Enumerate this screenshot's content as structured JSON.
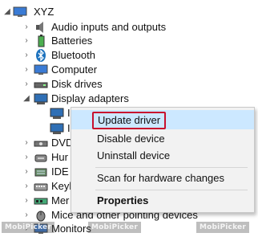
{
  "tree": {
    "root": {
      "label": "XYZ",
      "arrow": "◢"
    },
    "items": [
      {
        "label": "Audio inputs and outputs",
        "icon": "speaker-icon"
      },
      {
        "label": "Batteries",
        "icon": "battery-icon"
      },
      {
        "label": "Bluetooth",
        "icon": "bluetooth-icon"
      },
      {
        "label": "Computer",
        "icon": "computer-icon"
      },
      {
        "label": "Disk drives",
        "icon": "disk-drive-icon"
      },
      {
        "label": "Display adapters",
        "icon": "display-adapter-icon",
        "expanded": true
      },
      {
        "label": "DVD",
        "icon": "dvd-icon"
      },
      {
        "label": "Hur",
        "icon": "hid-icon"
      },
      {
        "label": "IDE A",
        "icon": "ide-icon"
      },
      {
        "label": "Keyb",
        "icon": "keyboard-icon"
      },
      {
        "label": "Mer",
        "icon": "memory-icon"
      },
      {
        "label": "Mice and other pointing devices",
        "icon": "mouse-icon"
      },
      {
        "label": "Monitors",
        "icon": "monitor-icon"
      }
    ],
    "children_prefix": [
      "I",
      "I"
    ]
  },
  "context_menu": {
    "update_driver": "Update driver",
    "disable_device": "Disable device",
    "uninstall_device": "Uninstall device",
    "scan_hardware": "Scan for hardware changes",
    "properties": "Properties"
  },
  "colors": {
    "highlight_bg": "#cce8ff",
    "highlight_border": "#c8102e",
    "menu_bg": "#f2f2f2"
  }
}
